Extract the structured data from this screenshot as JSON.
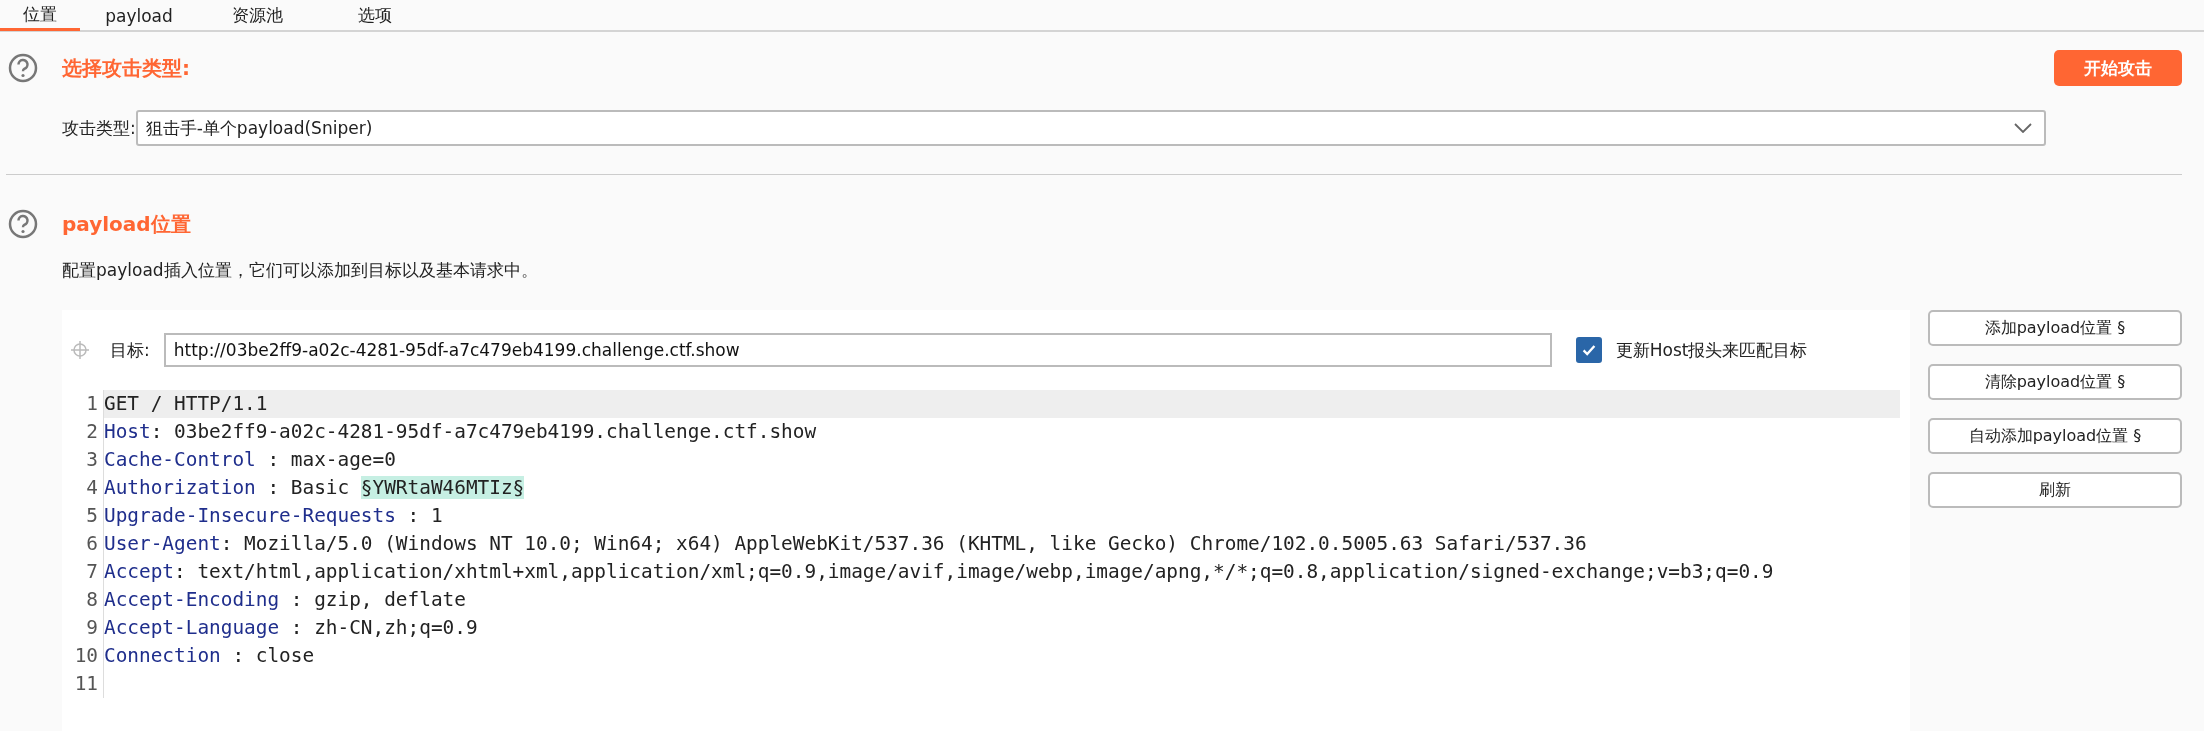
{
  "tabs": [
    {
      "label": "位置",
      "selected": true
    },
    {
      "label": "payload",
      "selected": false
    },
    {
      "label": "资源池",
      "selected": false
    },
    {
      "label": "选项",
      "selected": false
    }
  ],
  "attack_type": {
    "title": "选择攻击类型:",
    "start_button": "开始攻击",
    "label": "攻击类型:",
    "value": "狙击手-单个payload(Sniper)"
  },
  "positions": {
    "title": "payload位置",
    "description": "配置payload插入位置，它们可以添加到目标以及基本请求中。",
    "target": {
      "label": "目标:",
      "value": "http://03be2ff9-a02c-4281-95df-a7c479eb4199.challenge.ctf.show"
    },
    "update_host": {
      "label": "更新Host报头来匹配目标",
      "checked": true
    },
    "buttons": [
      "添加payload位置 §",
      "清除payload位置 §",
      "自动添加payload位置 §",
      "刷新"
    ],
    "lines": [
      {
        "number": "1",
        "kind": "request-line",
        "value": "GET / HTTP/1.1",
        "selected": true
      },
      {
        "number": "2",
        "kind": "header",
        "key": "Host",
        "value": ": 03be2ff9-a02c-4281-95df-a7c479eb4199.challenge.ctf.show",
        "selected": false
      },
      {
        "number": "3",
        "kind": "header",
        "key": "Cache-Control",
        "value": " : max-age=0",
        "selected": false
      },
      {
        "number": "4",
        "kind": "header",
        "key": "Authorization",
        "value": " : Basic ",
        "payload": "§YWRtaW46MTIz§",
        "selected": false
      },
      {
        "number": "5",
        "kind": "header",
        "key": "Upgrade-Insecure-Requests",
        "value": " : 1",
        "selected": false
      },
      {
        "number": "6",
        "kind": "header",
        "key": "User-Agent",
        "value": ": Mozilla/5.0 (Windows NT 10.0; Win64; x64) AppleWebKit/537.36 (KHTML, like Gecko) Chrome/102.0.5005.63 Safari/537.36",
        "selected": false
      },
      {
        "number": "7",
        "kind": "header",
        "key": "Accept",
        "value": ": text/html,application/xhtml+xml,application/xml;q=0.9,image/avif,image/webp,image/apng,*/*;q=0.8,application/signed-exchange;v=b3;q=0.9",
        "selected": false
      },
      {
        "number": "8",
        "kind": "header",
        "key": "Accept-Encoding",
        "value": " : gzip, deflate",
        "selected": false
      },
      {
        "number": "9",
        "kind": "header",
        "key": "Accept-Language",
        "value": " : zh-CN,zh;q=0.9",
        "selected": false
      },
      {
        "number": "10",
        "kind": "header",
        "key": "Connection",
        "value": " : close",
        "selected": false
      },
      {
        "number": "11",
        "kind": "blank",
        "selected": false
      }
    ]
  }
}
